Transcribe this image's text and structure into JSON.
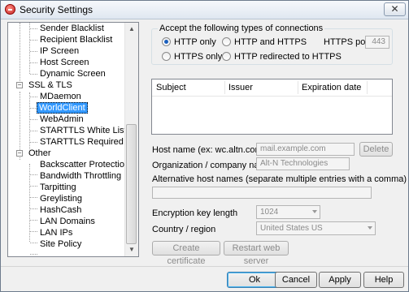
{
  "window": {
    "title": "Security Settings",
    "close_glyph": "✕"
  },
  "tree": {
    "items": [
      {
        "label": "Sender Blacklist"
      },
      {
        "label": "Recipient Blacklist"
      },
      {
        "label": "IP Screen"
      },
      {
        "label": "Host Screen"
      },
      {
        "label": "Dynamic Screen"
      },
      {
        "label": "SSL & TLS",
        "expander": "−"
      },
      {
        "label": "MDaemon"
      },
      {
        "label": "WorldClient",
        "selected": true
      },
      {
        "label": "WebAdmin"
      },
      {
        "label": "STARTTLS White List"
      },
      {
        "label": "STARTTLS Required List"
      },
      {
        "label": "Other",
        "expander": "−"
      },
      {
        "label": "Backscatter Protection"
      },
      {
        "label": "Bandwidth Throttling"
      },
      {
        "label": "Tarpitting"
      },
      {
        "label": "Greylisting"
      },
      {
        "label": "HashCash"
      },
      {
        "label": "LAN Domains"
      },
      {
        "label": "LAN IPs"
      },
      {
        "label": "Site Policy"
      }
    ],
    "scroll_up": "▲",
    "scroll_down": "▼"
  },
  "connections": {
    "group_label": "Accept the following types of connections",
    "options": {
      "http_only": "HTTP only",
      "http_and_https": "HTTP and HTTPS",
      "https_only": "HTTPS only",
      "http_redirected": "HTTP redirected to HTTPS"
    },
    "selected": "HTTP only",
    "https_port_label": "HTTPS port",
    "https_port_value": "443"
  },
  "cert_list": {
    "columns": [
      "Subject",
      "Issuer",
      "Expiration date"
    ]
  },
  "form": {
    "host_name_label": "Host name (ex: wc.altn.com)",
    "host_name_value": "mail.example.com",
    "delete_label": "Delete",
    "org_label": "Organization / company name",
    "org_value": "Alt-N Technologies",
    "alt_hosts_label": "Alternative host names (separate multiple entries with a comma)",
    "alt_hosts_value": "",
    "key_length_label": "Encryption key length",
    "key_length_value": "1024",
    "country_label": "Country / region",
    "country_value": "United States US",
    "create_cert_label": "Create certificate",
    "restart_label": "Restart web server"
  },
  "footer": {
    "ok": "Ok",
    "cancel": "Cancel",
    "apply": "Apply",
    "help": "Help"
  }
}
